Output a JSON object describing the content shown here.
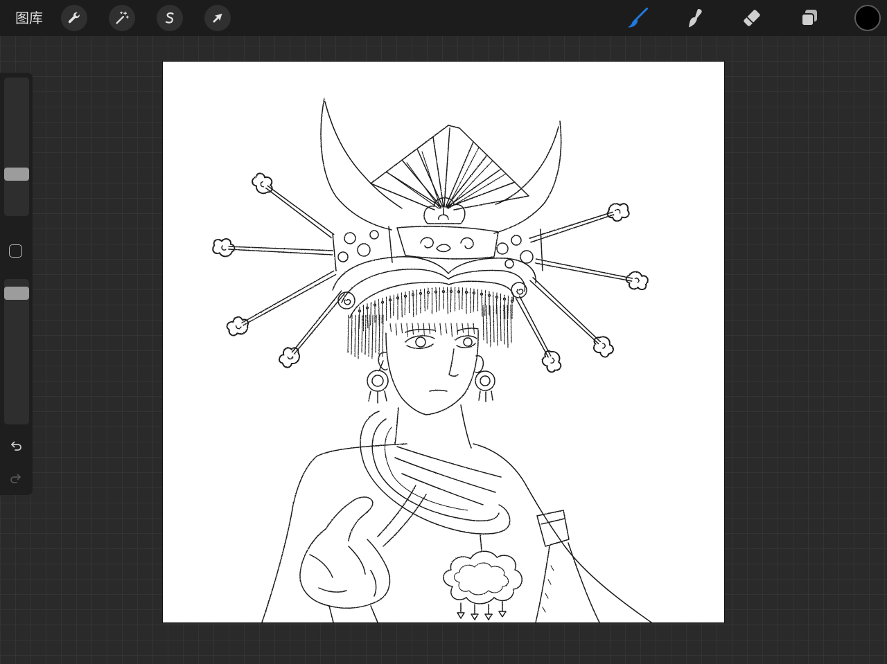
{
  "header": {
    "gallery_label": "图库",
    "left_tools": [
      {
        "icon": "wrench-icon"
      },
      {
        "icon": "magic-wand-icon"
      },
      {
        "icon": "selection-icon"
      },
      {
        "icon": "transform-arrow-icon"
      }
    ],
    "right_tools": [
      {
        "icon": "brush-icon",
        "active": true
      },
      {
        "icon": "smudge-icon",
        "active": false
      },
      {
        "icon": "eraser-icon",
        "active": false
      },
      {
        "icon": "layers-icon",
        "active": false
      },
      {
        "icon": "color-swatch-icon",
        "active": false
      }
    ]
  },
  "sidebar": {
    "brush_size": 0.28,
    "opacity": 0.94,
    "modify_icon": "square-icon",
    "undo_icon": "undo-icon",
    "redo_icon": "redo-icon",
    "redo_enabled": false
  },
  "colors": {
    "accent": "#1f7ae0",
    "current_color": "#000000",
    "canvas": "#ffffff",
    "toolbar_bg": "#1c1c1c",
    "workspace_bg": "#2a2a2a"
  }
}
